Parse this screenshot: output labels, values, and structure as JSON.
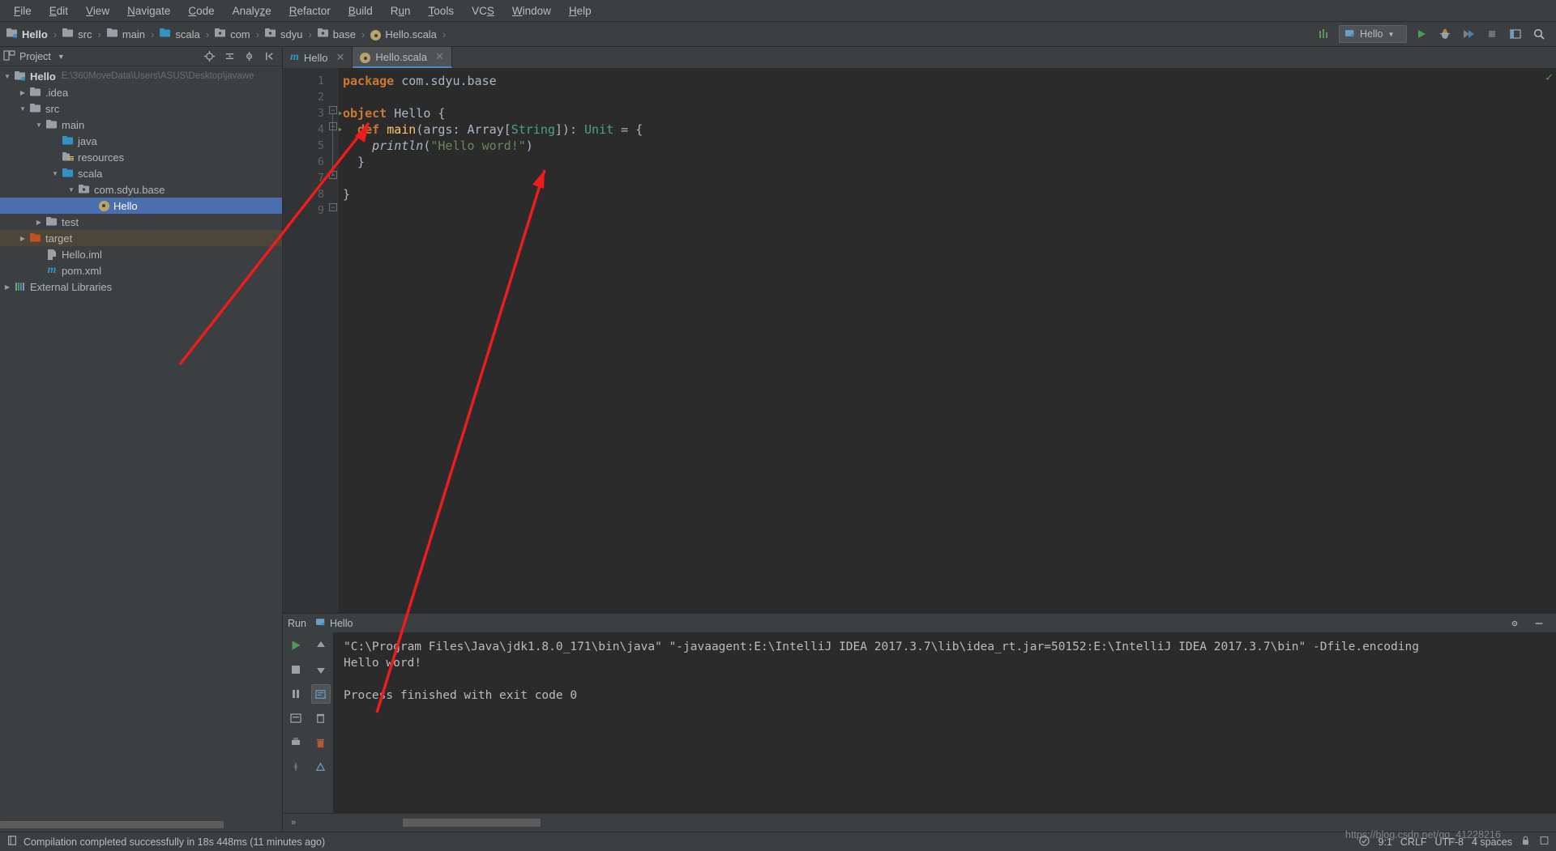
{
  "menubar": {
    "items": [
      "File",
      "Edit",
      "View",
      "Navigate",
      "Code",
      "Analyze",
      "Refactor",
      "Build",
      "Run",
      "Tools",
      "VCS",
      "Window",
      "Help"
    ]
  },
  "breadcrumb": {
    "items": [
      {
        "label": "Hello",
        "icon": "module-icon"
      },
      {
        "label": "src",
        "icon": "folder-icon"
      },
      {
        "label": "main",
        "icon": "folder-icon"
      },
      {
        "label": "scala",
        "icon": "source-folder-icon"
      },
      {
        "label": "com",
        "icon": "package-icon"
      },
      {
        "label": "sdyu",
        "icon": "package-icon"
      },
      {
        "label": "base",
        "icon": "package-icon"
      },
      {
        "label": "Hello.scala",
        "icon": "scala-object-icon"
      }
    ],
    "separator": "›"
  },
  "toolbar_right": {
    "run_config": "Hello",
    "buttons": [
      "run-button",
      "debug-button",
      "coverage-button",
      "stop-button",
      "settings-button",
      "search-button"
    ]
  },
  "project_panel": {
    "title": "Project",
    "tree": [
      {
        "label": "Hello",
        "path": "E:\\360MoveData\\Users\\ASUS\\Desktop\\javawe",
        "indent": 0,
        "arrow": "down",
        "icon": "module-icon",
        "bold": true,
        "state": "normal"
      },
      {
        "label": ".idea",
        "path": "",
        "indent": 1,
        "arrow": "right",
        "icon": "folder-icon",
        "bold": false,
        "state": "normal"
      },
      {
        "label": "src",
        "path": "",
        "indent": 1,
        "arrow": "down",
        "icon": "folder-icon",
        "bold": false,
        "state": "normal"
      },
      {
        "label": "main",
        "path": "",
        "indent": 2,
        "arrow": "down",
        "icon": "folder-icon",
        "bold": false,
        "state": "normal"
      },
      {
        "label": "java",
        "path": "",
        "indent": 3,
        "arrow": "none",
        "icon": "source-folder-icon",
        "bold": false,
        "state": "normal"
      },
      {
        "label": "resources",
        "path": "",
        "indent": 3,
        "arrow": "none",
        "icon": "resources-folder-icon",
        "bold": false,
        "state": "normal"
      },
      {
        "label": "scala",
        "path": "",
        "indent": 3,
        "arrow": "down",
        "icon": "source-folder-icon",
        "bold": false,
        "state": "normal"
      },
      {
        "label": "com.sdyu.base",
        "path": "",
        "indent": 4,
        "arrow": "down",
        "icon": "package-icon",
        "bold": false,
        "state": "normal"
      },
      {
        "label": "Hello",
        "path": "",
        "indent": 5,
        "arrow": "none",
        "icon": "scala-object-icon",
        "bold": false,
        "state": "selected"
      },
      {
        "label": "test",
        "path": "",
        "indent": 2,
        "arrow": "right",
        "icon": "folder-icon",
        "bold": false,
        "state": "normal"
      },
      {
        "label": "target",
        "path": "",
        "indent": 1,
        "arrow": "right",
        "icon": "excluded-folder-icon",
        "bold": false,
        "state": "target"
      },
      {
        "label": "Hello.iml",
        "path": "",
        "indent": 2,
        "arrow": "none",
        "icon": "iml-file-icon",
        "bold": false,
        "state": "normal"
      },
      {
        "label": "pom.xml",
        "path": "",
        "indent": 2,
        "arrow": "none",
        "icon": "maven-icon",
        "bold": false,
        "state": "normal"
      },
      {
        "label": "External Libraries",
        "path": "",
        "indent": 0,
        "arrow": "right",
        "icon": "libraries-icon",
        "bold": false,
        "state": "normal"
      }
    ]
  },
  "editor": {
    "tabs": [
      {
        "label": "Hello",
        "icon": "maven-icon",
        "active": false
      },
      {
        "label": "Hello.scala",
        "icon": "scala-object-icon",
        "active": true
      }
    ],
    "line_numbers": [
      "1",
      "2",
      "3",
      "4",
      "5",
      "6",
      "7",
      "8",
      "9"
    ],
    "code_lines": [
      {
        "n": 1,
        "text": "package com.sdyu.base"
      },
      {
        "n": 2,
        "text": ""
      },
      {
        "n": 3,
        "text": "object Hello {"
      },
      {
        "n": 4,
        "text": "  def main(args: Array[String]): Unit = {"
      },
      {
        "n": 5,
        "text": "    println(\"Hello word!\")"
      },
      {
        "n": 6,
        "text": "  }"
      },
      {
        "n": 7,
        "text": ""
      },
      {
        "n": 8,
        "text": "}"
      },
      {
        "n": 9,
        "text": ""
      }
    ],
    "inspection_status": "ok"
  },
  "run_panel": {
    "title": "Run",
    "tab_label": "Hello",
    "console_lines": [
      "\"C:\\Program Files\\Java\\jdk1.8.0_171\\bin\\java\" \"-javaagent:E:\\IntelliJ IDEA 2017.3.7\\lib\\idea_rt.jar=50152:E:\\IntelliJ IDEA 2017.3.7\\bin\" -Dfile.encoding",
      "Hello word!",
      "",
      "Process finished with exit code 0"
    ]
  },
  "status_bar": {
    "message": "Compilation completed successfully in 18s 448ms (11 minutes ago)",
    "caret_position": "9:1",
    "line_separator": "CRLF",
    "encoding": "UTF-8",
    "indent": "4 spaces",
    "watermark": "https://blog.csdn.net/qq_41228216"
  },
  "colors": {
    "accent": "#4b6eaf",
    "keyword": "#cc7832",
    "string": "#6a8759",
    "function": "#ffc66d",
    "type": "#4e9f91",
    "arrow_annotation": "#ef1c1c",
    "background": "#3c3f41",
    "editor_background": "#2b2b2b"
  }
}
